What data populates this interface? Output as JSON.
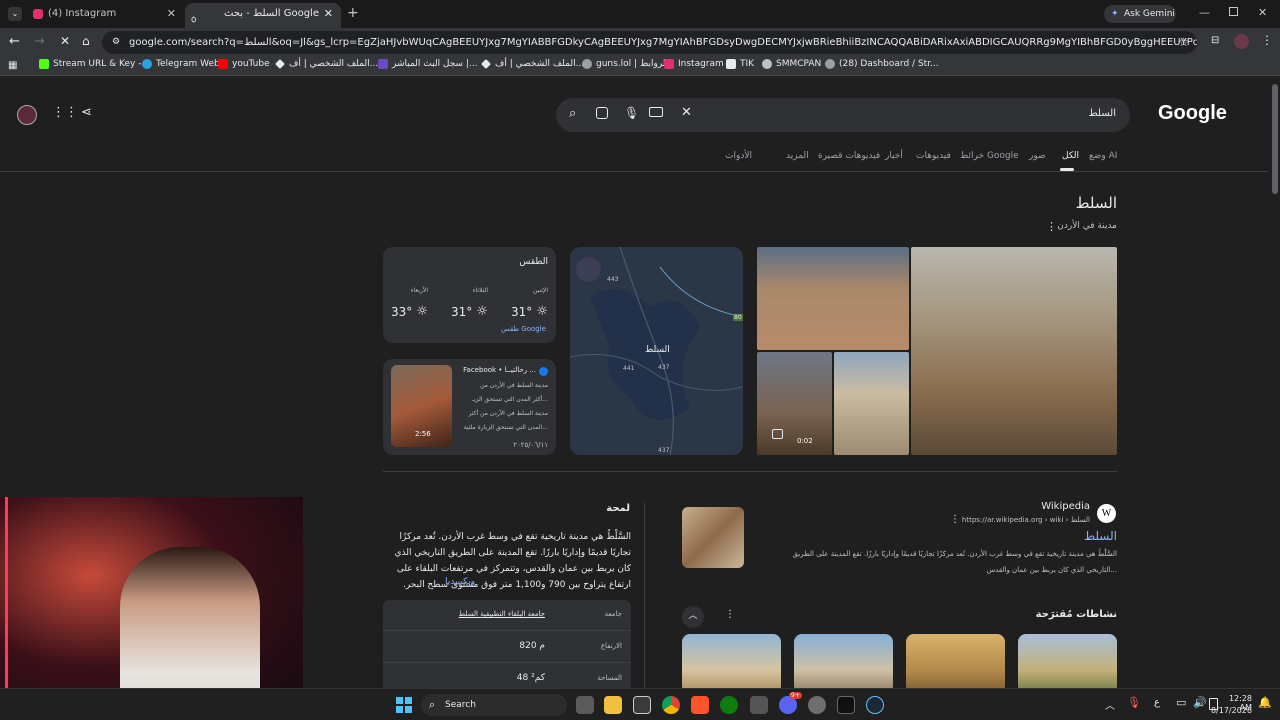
{
  "browser": {
    "tabs": [
      {
        "label": "(4) Instagram",
        "icon": "instagram-icon",
        "active": false
      },
      {
        "label": "السلط - بحث Google",
        "icon": "google-icon",
        "active": true
      }
    ],
    "new_tab": "+",
    "ask_gemini": "Ask Gemini",
    "url": "google.com/search?q=السلط&oq=Jl&gs_lcrp=EgZjaHJvbWUqCAgBEEUYJxg7MgYIABBFGDkyCAgBEEUYJxg7MgYIAhBFGDsyDwgDECMYJxjwBRieBhiiBzINCAQQABiDARixAxiABDIGCAUQRRg9MgYIBhBFGD0yBggHEEUYPdIBCDIxMDBqMGo3qAIIsAIB8QUu..."
  },
  "bookmarks": [
    {
      "label": "Stream URL & Key -...",
      "color": "#53fc18"
    },
    {
      "label": "Telegram Web",
      "color": "#2aa3de"
    },
    {
      "label": "youTube",
      "color": "#ff0000"
    },
    {
      "label": "الملف الشخصي | أف...",
      "color": "#e8eaed"
    },
    {
      "label": "سجل البث المباشر |...",
      "color": "#6a4bc4"
    },
    {
      "label": "الملف الشخصي | أف...",
      "color": "#e8eaed"
    },
    {
      "label": "guns.lol | الروابط",
      "color": "#9aa0a6"
    },
    {
      "label": "Instagram",
      "color": "#e1306c"
    },
    {
      "label": "TIK",
      "color": "#e8eaed"
    },
    {
      "label": "SMMCPAN",
      "color": "#bdc1c6"
    },
    {
      "label": "(28) Dashboard / Str...",
      "color": "#9aa0a6"
    }
  ],
  "search": {
    "query": "السلط",
    "logo": "Google",
    "tabs": [
      "وضع AI",
      "الكل",
      "صور",
      "خرائط Google",
      "فيديوهات",
      "أخبار",
      "فيديوهات قصيرة",
      "المزيد",
      "الأدوات"
    ]
  },
  "knowledge": {
    "title": "السلط",
    "subtitle": "مدينة في الأردن",
    "weather": {
      "header": "الطقس",
      "days": [
        {
          "day": "الإثنين",
          "temp": "31°"
        },
        {
          "day": "الثلاثاء",
          "temp": "31°"
        },
        {
          "day": "الأربعاء",
          "temp": "33°"
        }
      ],
      "source": "طقس Google"
    },
    "facebook": {
      "source": "Facebook • رحالتيــا ...",
      "text1": "مدينة السلط في الأردن من",
      "text2": "أكثر المدن التي تستحق الزيـ...",
      "text3": "مدينة السلط في الأردن من أكثر",
      "text4": "المدن التي تستحق الزيارة ملئية...",
      "duration": "2:56",
      "date": "٢٠٢٥/٠٦/١١"
    },
    "map": {
      "city": "السلط",
      "roads": [
        "443",
        "441",
        "437",
        "437"
      ],
      "highway": "80"
    },
    "image_video_duration": "0:02"
  },
  "overview": {
    "header": "لمحة",
    "text": "السَّلْطُ هي مدينة تاريخية تقع في وسط غرب الأردن. تُعد مركزًا تجاريًا قديمًا وإداريًا بارزًا. تقع المدينة على الطريق التاريخي الذي كان يربط بين عمان والقدس، وتتمركز في مرتفعات البلقاء على ارتفاع يتراوح بين 790 و1,100 متر فوق مستوى سطح البحر.",
    "link": "ويكيبيديا",
    "facts": [
      {
        "label": "جامعة",
        "value": "جامعة البلقاء التطبيقية السلط"
      },
      {
        "label": "الارتفاع",
        "value": "820 م"
      },
      {
        "label": "المساحة",
        "value": "48 كم²"
      }
    ]
  },
  "wiki_result": {
    "site": "Wikipedia",
    "breadcrumb": "https://ar.wikipedia.org › wiki › السلط",
    "title": "السلط",
    "snippet1": "السَّلْطُ هي مدينة تاريخية تقع في وسط غرب الأردن. تُعد مركزًا تجاريًا قديمًا وإداريًا بارزًا. تقع المدينة على الطريق",
    "snippet2": "التاريخي الذي كان يربط بين عمان والقدس..."
  },
  "activities": {
    "header": "نشاطات مُقترَحة"
  },
  "taskbar": {
    "search": "Search",
    "lang": "ع",
    "time": "12:28 AM",
    "date": "8/17/2026",
    "notif_badge": "9+"
  }
}
